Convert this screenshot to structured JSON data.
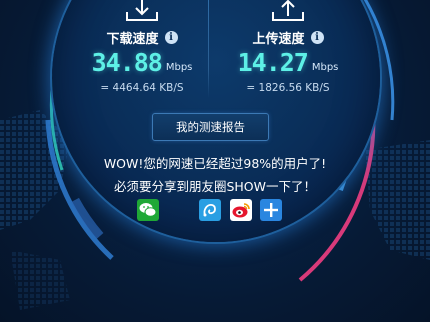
{
  "download": {
    "label": "下载速度",
    "speed": "34.88",
    "unit": "Mbps",
    "kbs": "= 4464.64  KB/S",
    "icon": "download-arrow-icon"
  },
  "upload": {
    "label": "上传速度",
    "speed": "14.27",
    "unit": "Mbps",
    "kbs": "= 1826.56  KB/S",
    "icon": "upload-arrow-icon"
  },
  "info_glyph": "i",
  "report_button": "我的测速报告",
  "message": {
    "line1": "WOW!您的网速已经超过98%的用户了!",
    "line2": "必须要分享到朋友圈SHOW一下了！"
  },
  "share": [
    {
      "name": "wechat-icon",
      "color": "#1fa836"
    },
    {
      "name": "pengyou-icon",
      "color": "#2a9fe3"
    },
    {
      "name": "weibo-icon",
      "color": "#e6162d"
    },
    {
      "name": "more-share-icon",
      "color": "#2a86e0"
    }
  ],
  "colors": {
    "background": "#06172f",
    "speed_digits": "#5df0e6",
    "arc_teal": "#2fc9b0",
    "arc_pink": "#d83a7a",
    "arc_blue": "#3b8fe0"
  }
}
